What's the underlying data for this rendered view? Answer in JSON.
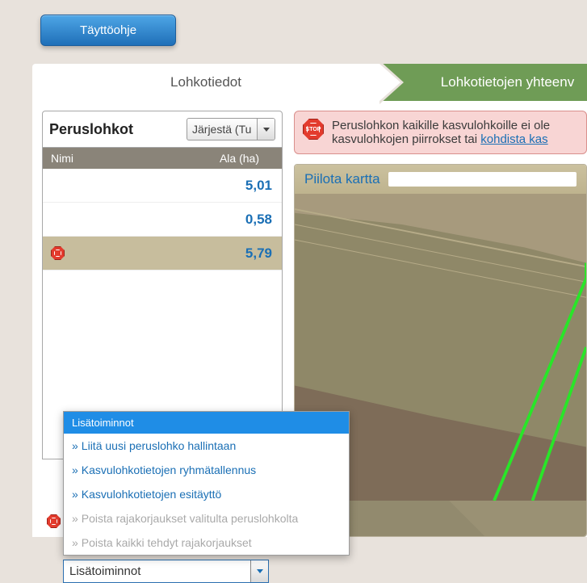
{
  "top": {
    "help_button": "Täyttöohje"
  },
  "tabs": {
    "first": "Lohkotiedot",
    "second": "Lohkotietojen yhteenv"
  },
  "sidebar": {
    "title": "Peruslohkot",
    "sort_label": "Järjestä (Tu",
    "col_name": "Nimi",
    "col_area": "Ala (ha)",
    "rows": [
      {
        "area": "5,01",
        "selected": false,
        "stop": false
      },
      {
        "area": "0,58",
        "selected": false,
        "stop": false
      },
      {
        "area": "5,79",
        "selected": true,
        "stop": true
      }
    ],
    "dropdown": {
      "header": "Lisätoiminnot",
      "options": [
        {
          "label": "Liitä uusi peruslohko hallintaan",
          "enabled": true
        },
        {
          "label": "Kasvulohkotietojen ryhmätallennus",
          "enabled": true
        },
        {
          "label": "Kasvulohkotietojen esitäyttö",
          "enabled": true
        },
        {
          "label": "Poista rajakorjaukset valitulta peruslohkolta",
          "enabled": false
        },
        {
          "label": "Poista kaikki tehdyt rajakorjaukset",
          "enabled": false
        }
      ],
      "combo_label": "Lisätoiminnot"
    }
  },
  "alert": {
    "text1": "Peruslohkon kaikille kasvulohkoille ei ole",
    "text2": "kasvulohkojen piirrokset tai ",
    "link": "kohdista kas"
  },
  "map": {
    "toggle": "Piilota kartta"
  }
}
